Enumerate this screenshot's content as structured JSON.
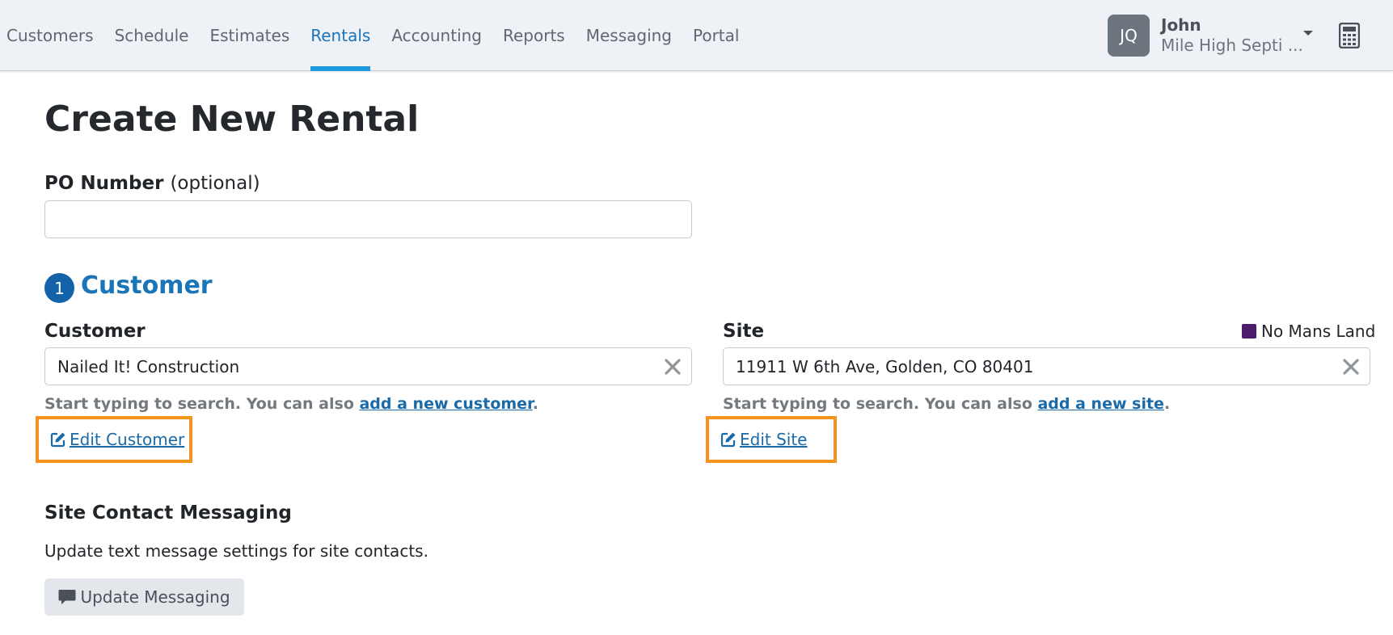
{
  "nav": {
    "items": [
      {
        "label": "Customers"
      },
      {
        "label": "Schedule"
      },
      {
        "label": "Estimates"
      },
      {
        "label": "Rentals"
      },
      {
        "label": "Accounting"
      },
      {
        "label": "Reports"
      },
      {
        "label": "Messaging"
      },
      {
        "label": "Portal"
      }
    ],
    "active": "Rentals"
  },
  "user": {
    "initials": "JQ",
    "name": "John",
    "company": "Mile High Septi ..."
  },
  "icons": {
    "calculator": "calculator-icon",
    "clear": "close-icon",
    "edit": "edit-icon",
    "comment": "comment-icon",
    "caret": "caret-down-icon"
  },
  "colors": {
    "accent": "#1a74b8",
    "highlight_box": "#f5921e",
    "zone_swatch": "#4b1c6b"
  },
  "page": {
    "title": "Create New Rental"
  },
  "po": {
    "label": "PO Number",
    "optional": "(optional)",
    "value": ""
  },
  "step": {
    "number": "1",
    "title": "Customer"
  },
  "customer": {
    "label": "Customer",
    "value": "Nailed It! Construction",
    "help_prefix": "Start typing to search. You can also ",
    "help_link": "add a new customer",
    "help_suffix": ".",
    "edit_label": " Edit Customer"
  },
  "site": {
    "label": "Site",
    "zone": "No Mans Land",
    "value": "11911 W 6th Ave, Golden, CO 80401",
    "help_prefix": "Start typing to search. You can also ",
    "help_link": "add a new site",
    "help_suffix": ".",
    "edit_label": " Edit Site"
  },
  "messaging": {
    "heading": "Site Contact Messaging",
    "description": "Update text message settings for site contacts.",
    "button": "Update Messaging"
  }
}
